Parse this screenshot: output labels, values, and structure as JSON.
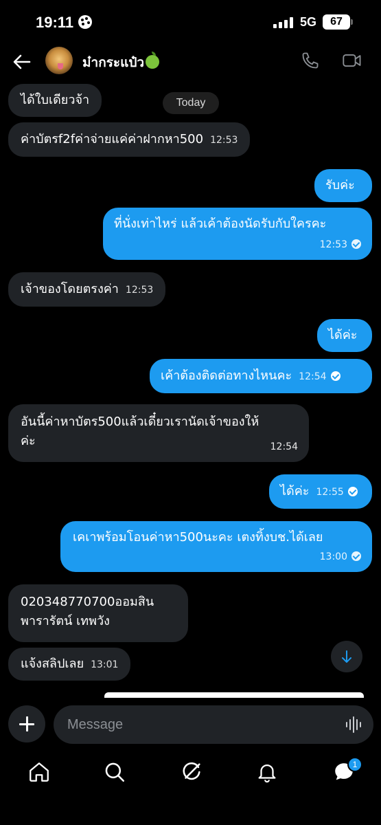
{
  "status_bar": {
    "time": "19:11",
    "network": "5G",
    "battery": "67"
  },
  "header": {
    "contact_name": "ม๋ากระแป๋ว"
  },
  "date_separator": "Today",
  "messages": [
    {
      "dir": "in",
      "text": "ได้ใบเดียวจ้า",
      "time": ""
    },
    {
      "dir": "in",
      "text": "ค่าบัตรf2fค่าจ่ายแค่ค่าฝากหา500",
      "time": "12:53"
    },
    {
      "dir": "out",
      "text": "รับค่ะ",
      "time": ""
    },
    {
      "dir": "out",
      "text": "ที่นั่งเท่าไหร่ แล้วเค้าต้องนัดรับกับใครคะ",
      "time": "12:53"
    },
    {
      "dir": "in",
      "text": "เจ้าของโดยตรงค่า",
      "time": "12:53"
    },
    {
      "dir": "out",
      "text": "ได้ค่ะ",
      "time": ""
    },
    {
      "dir": "out",
      "text": "เค้าต้องติดต่อทางไหนคะ",
      "time": "12:54"
    },
    {
      "dir": "in",
      "text": "อันนี้ค่าหาบัตร500แล้วเดี๋ยวเรานัดเจ้าของให้ค่ะ",
      "line1": "อันนี้ค่าหาบัตร500แล้วเดี๋ยวเรานัดเจ้าของให้",
      "line2": "ค่ะ",
      "time": "12:54"
    },
    {
      "dir": "out",
      "text": "ได้ค่ะ",
      "time": "12:55"
    },
    {
      "dir": "out",
      "text": "เคเาพร้อมโอนค่าหา500นะคะ เตงทิ้งบช.ได้เลย",
      "time": "13:00"
    },
    {
      "dir": "in",
      "text": "020348770700ออมสิน พารารัตน์ เทพวัง",
      "line1": "020348770700ออมสิน",
      "line2": "พารารัตน์ เทพวัง",
      "time": ""
    },
    {
      "dir": "in",
      "text": "แจ้งสลิปเลย",
      "time": "13:01"
    }
  ],
  "composer": {
    "placeholder": "Message"
  },
  "nav": {
    "items": [
      "home-icon",
      "search-icon",
      "grok-icon",
      "bell-icon",
      "messages-icon"
    ],
    "messages_badge": "1"
  },
  "colors": {
    "accent": "#1d9bf0",
    "incoming_bubble": "#202327",
    "background": "#000000"
  }
}
